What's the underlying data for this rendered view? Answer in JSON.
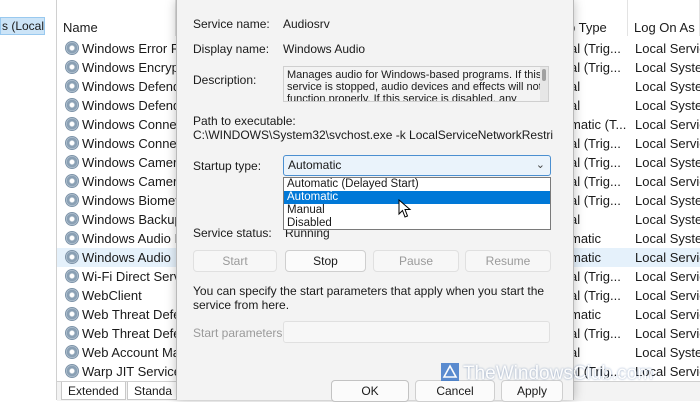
{
  "tree": {
    "selected_label": "s (Local)"
  },
  "columns": {
    "name": "Name",
    "startup": "p Type",
    "logon": "Log On As"
  },
  "services": [
    {
      "name": "Windows Error R",
      "startup": "al (Trig...",
      "logon": "Local Service",
      "selected": false
    },
    {
      "name": "Windows Encrypt",
      "startup": "al (Trig...",
      "logon": "Local Syste...",
      "selected": false
    },
    {
      "name": "Windows Defend",
      "startup": "al",
      "logon": "Local Syste...",
      "selected": false
    },
    {
      "name": "Windows Defend",
      "startup": "al",
      "logon": "Local Syste...",
      "selected": false
    },
    {
      "name": "Windows Conne",
      "startup": "matic (T...",
      "logon": "Local Service",
      "selected": false
    },
    {
      "name": "Windows Conne",
      "startup": "al (Trig...",
      "logon": "Local Service",
      "selected": false
    },
    {
      "name": "Windows Camera",
      "startup": "al (Trig...",
      "logon": "Local Syste...",
      "selected": false
    },
    {
      "name": "Windows Camera",
      "startup": "al (Trig...",
      "logon": "Local Service",
      "selected": false
    },
    {
      "name": "Windows Biomet",
      "startup": "al (Trig...",
      "logon": "Local Syste...",
      "selected": false
    },
    {
      "name": "Windows Backup",
      "startup": "al",
      "logon": "Local Syste...",
      "selected": false
    },
    {
      "name": "Windows Audio I",
      "startup": "matic",
      "logon": "Local Syste...",
      "selected": false
    },
    {
      "name": "Windows Audio",
      "startup": "matic",
      "logon": "Local Service",
      "selected": true
    },
    {
      "name": "Wi-Fi Direct Servi",
      "startup": "al (Trig...",
      "logon": "Local Service",
      "selected": false
    },
    {
      "name": "WebClient",
      "startup": "al (Trig...",
      "logon": "Local Service",
      "selected": false
    },
    {
      "name": "Web Threat Defe",
      "startup": "matic",
      "logon": "Local Service",
      "selected": false
    },
    {
      "name": "Web Threat Defe",
      "startup": "al (Trig...",
      "logon": "Local Service",
      "selected": false
    },
    {
      "name": "Web Account Ma",
      "startup": "al",
      "logon": "Local Syste...",
      "selected": false
    },
    {
      "name": "Warp JIT Service",
      "startup": "al (Trig...",
      "logon": "Local Service",
      "selected": false
    }
  ],
  "bottom_tabs": [
    "Extended",
    "Standa"
  ],
  "dialog": {
    "service_name_label": "Service name:",
    "service_name": "Audiosrv",
    "display_name_label": "Display name:",
    "display_name": "Windows Audio",
    "description_label": "Description:",
    "description": "Manages audio for Windows-based programs.  If this service is stopped, audio devices and effects will not function properly.  If this service is disabled, any",
    "path_label": "Path to executable:",
    "path": "C:\\WINDOWS\\System32\\svchost.exe -k LocalServiceNetworkRestricted -p",
    "startup_type_label": "Startup type:",
    "startup_type_value": "Automatic",
    "startup_options": [
      {
        "label": "Automatic (Delayed Start)",
        "active": false
      },
      {
        "label": "Automatic",
        "active": true
      },
      {
        "label": "Manual",
        "active": false
      },
      {
        "label": "Disabled",
        "active": false
      }
    ],
    "service_status_label": "Service status:",
    "service_status": "Running",
    "buttons": {
      "start": "Start",
      "stop": "Stop",
      "pause": "Pause",
      "resume": "Resume"
    },
    "hint": "You can specify the start parameters that apply when you start the service from here.",
    "start_params_label": "Start parameters:",
    "footer": {
      "ok": "OK",
      "cancel": "Cancel",
      "apply": "Apply"
    }
  },
  "watermark": {
    "text": "TheWindowsClub.com"
  },
  "colors": {
    "selection": "#0078d7",
    "selected_row": "#e5f1fb",
    "dialog_bg": "#f3f3f3"
  }
}
